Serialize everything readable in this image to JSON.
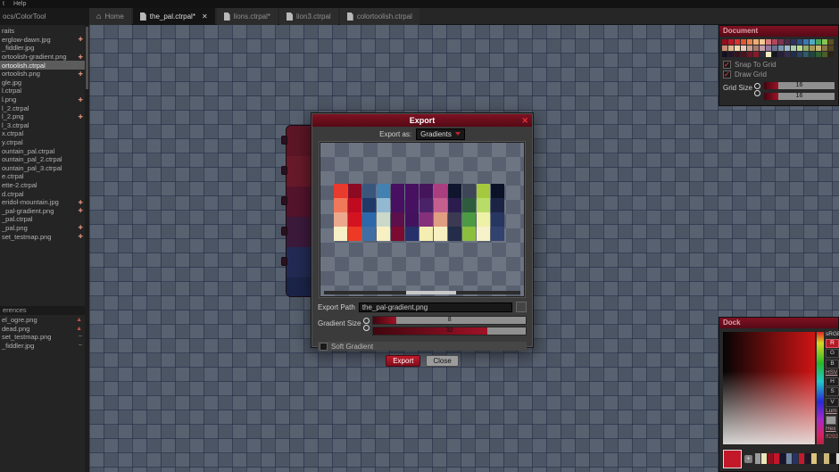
{
  "menubar": {
    "items": [
      "t",
      "Help"
    ]
  },
  "tabs": [
    {
      "label": "Home",
      "icon": "home",
      "active": false
    },
    {
      "label": "the_pal.ctrpal*",
      "icon": "file",
      "active": true,
      "close": "✕"
    },
    {
      "label": "lions.ctrpal*",
      "icon": "file",
      "active": false
    },
    {
      "label": "lion3.ctrpal",
      "icon": "file",
      "active": false
    },
    {
      "label": "colortoolish.ctrpal",
      "icon": "file",
      "active": false
    }
  ],
  "sidebar": {
    "title": "ocs/ColorTool",
    "files": [
      {
        "label": "raits"
      },
      {
        "label": "erglow-dawn.jpg",
        "add": true
      },
      {
        "label": "_fiddler.jpg"
      },
      {
        "label": "ortoolish-gradient.png",
        "add": true
      },
      {
        "label": "ortoolish.ctrpal",
        "selected": true
      },
      {
        "label": "ortoolish.png",
        "add": true
      },
      {
        "label": "gle.jpg"
      },
      {
        "label": "l.ctrpal"
      },
      {
        "label": "l.png",
        "add": true
      },
      {
        "label": "l_2.ctrpal"
      },
      {
        "label": "l_2.png",
        "add": true
      },
      {
        "label": "l_3.ctrpal"
      },
      {
        "label": "x.ctrpal"
      },
      {
        "label": "y.ctrpal"
      },
      {
        "label": "ountain_pal.ctrpal"
      },
      {
        "label": "ountain_pal_2.ctrpal"
      },
      {
        "label": "ountain_pal_3.ctrpal"
      },
      {
        "label": "e.ctrpal"
      },
      {
        "label": "ette-2.ctrpal"
      },
      {
        "label": "d.ctrpal"
      },
      {
        "label": "eridol-mountain.jpg",
        "add": true
      },
      {
        "label": "_pal-gradient.png",
        "add": true
      },
      {
        "label": "_pal.ctrpal"
      },
      {
        "label": "_pal.png",
        "add": true
      },
      {
        "label": "set_testmap.png",
        "add": true
      }
    ],
    "references": {
      "header": "erences",
      "items": [
        {
          "label": "el_ogre.png",
          "icon": "warning"
        },
        {
          "label": "dead.png",
          "icon": "warning"
        },
        {
          "label": "set_testmap.png",
          "icon": "tilde"
        },
        {
          "label": "_fiddler.jpg",
          "icon": "tilde"
        }
      ]
    }
  },
  "dialog": {
    "title": "Export",
    "close_icon": "✕",
    "export_as_label": "Export as:",
    "export_as_value": "Gradients",
    "export_path_label": "Export Path",
    "export_path_value": "the_pal-gradient.png",
    "gradient_size_label": "Gradient Size",
    "gradient_size_values": [
      "8",
      "32"
    ],
    "soft_gradient_label": "Soft Gradient",
    "soft_gradient_checked": false,
    "export_button": "Export",
    "close_button": "Close",
    "preview_columns": [
      [
        "#e93a2e",
        "#f0795a",
        "#eca88c",
        "#f7f0c6"
      ],
      [
        "#8c0a22",
        "#c00a20",
        "#d41321",
        "#ee3a24"
      ],
      [
        "#3a567c",
        "#1f3a69",
        "#2d68ab",
        "#3f6fa5"
      ],
      [
        "#4381b1",
        "#93b9d2",
        "#cad9ca",
        "#f7f0c2"
      ],
      [
        "#471061",
        "#471061",
        "#5c0f4a",
        "#7d0a30"
      ],
      [
        "#471061",
        "#471061",
        "#44115e",
        "#26306a"
      ],
      [
        "#44155a",
        "#4a2268",
        "#84307a",
        "#f4eeb2"
      ],
      [
        "#a93f7e",
        "#c4608f",
        "#df9d82",
        "#f6f0c0"
      ],
      [
        "#10152e",
        "#2a1c4c",
        "#3c3a52",
        "#232c48"
      ],
      [
        "#3e4557",
        "#2e5c3e",
        "#4c9a44",
        "#8cbf3e"
      ],
      [
        "#a5c93e",
        "#b8dc68",
        "#eef2a6",
        "#f8f2ca"
      ],
      [
        "#0b1126",
        "#1b2445",
        "#273761",
        "#31426e"
      ]
    ]
  },
  "document_panel": {
    "header": "Document",
    "palette_rows": [
      [
        "#8c101e",
        "#c01828",
        "#d83232",
        "#e0562f",
        "#e8824e",
        "#eeac72",
        "#f2c894",
        "#d87c80",
        "#b0485c",
        "#7e3450",
        "#4e2a4a",
        "#323062",
        "#2a5088",
        "#3c78b0",
        "#52aac0",
        "#48a45c",
        "#88c454",
        "#5e501e"
      ],
      [
        "#c89078",
        "#e0b890",
        "#f0d8ac",
        "#e8c8b8",
        "#c8a08c",
        "#a87c6c",
        "#c49cac",
        "#94789c",
        "#6c7090",
        "#7c94ac",
        "#9cb8c8",
        "#a8ccb0",
        "#b8d890",
        "#90ac6c",
        "#a89858",
        "#c4b478",
        "#887448",
        "#54421e"
      ],
      [
        "#141020",
        "#241428",
        "#381022",
        "#52101e",
        "#6e1426",
        "#8c1828",
        "#2c2c3c",
        "#f4ecc2",
        "#16161e",
        "#262038",
        "#362a50",
        "#1e2e50",
        "#26425e",
        "#2e5a6a",
        "#20483a",
        "#2e5e32",
        "#4a5e2a",
        "#2a2212"
      ]
    ],
    "snap_to_grid_label": "Snap To Grid",
    "snap_to_grid_checked": true,
    "draw_grid_label": "Draw Grid",
    "draw_grid_checked": true,
    "grid_size_label": "Grid Size",
    "grid_size_values": [
      "16",
      "16"
    ]
  },
  "dock_panel": {
    "header": "Dock",
    "srgb_label": "sRGB",
    "channels": [
      "R",
      "G",
      "B"
    ],
    "hsv_label": "HSV",
    "hsv_channels": [
      "H",
      "S",
      "V"
    ],
    "lum_label": "Lum",
    "hex_label": "Hex",
    "hex_value": "ff292",
    "current_color": "#c2182a",
    "add_button": "+",
    "swatches": [
      "#9a9a9a",
      "#eee6ba",
      "#8e1120",
      "#c3162a",
      "#16162c",
      "#7286a6",
      "#24346a",
      "#c21a2e",
      "#201426",
      "#dcc47e",
      "#2e2e2e",
      "#ccb87a",
      "#141414",
      "#dcd8d2"
    ]
  },
  "canvas": {
    "palette_object_segments": [
      "#5c1626",
      "#681a2a",
      "#54142c",
      "#3c1a3c",
      "#232b54",
      "#1b2548"
    ]
  },
  "colors": {
    "accent_red": "#a01228",
    "panel_header": "#7e1122",
    "canvas_check_light": "#58616f",
    "canvas_check_dark": "#4c5563"
  }
}
